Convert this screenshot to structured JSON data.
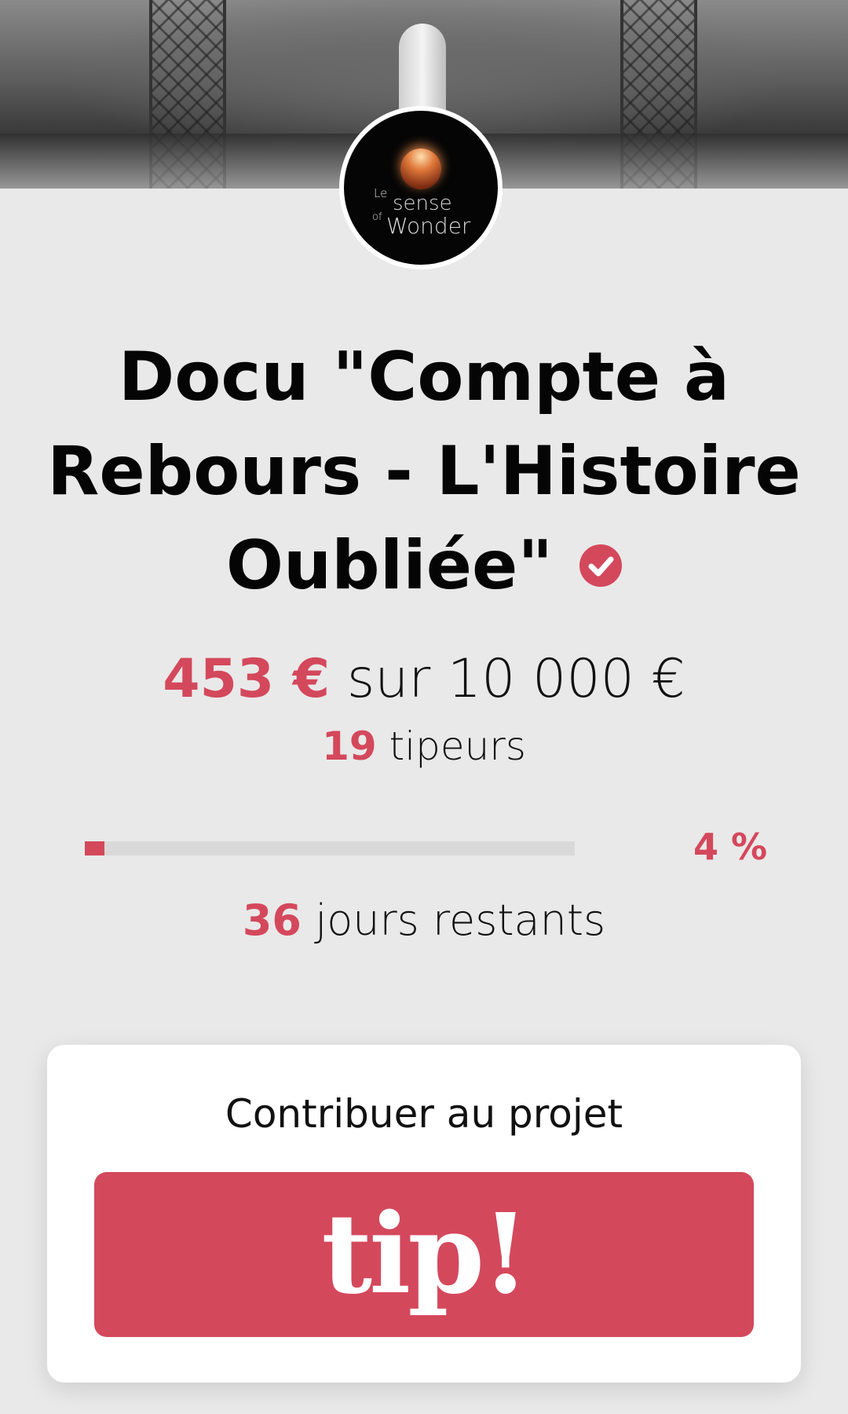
{
  "cover": {
    "image": "rocket-launch-photo"
  },
  "logo": {
    "le": "Le",
    "sense": "sense",
    "of": "of",
    "wonder": "Wonder",
    "image": "planet-sunrise"
  },
  "project": {
    "title_line1": "Docu \"Compte à",
    "title_line2": "Rebours - L'Histoire",
    "title_line3": "Oubliée\"",
    "verified_icon": "check-circle-icon"
  },
  "funding": {
    "raised": "453 €",
    "goal_text": "sur 10 000 €",
    "tippers_count": "19",
    "tippers_label": "tipeurs",
    "percent": 4,
    "percent_label": "4 %",
    "days_count": "36",
    "days_label": "jours restants"
  },
  "contribute": {
    "heading": "Contribuer au projet",
    "button_label": "tip!"
  },
  "colors": {
    "accent": "#d4485c",
    "background": "#e9e9e9"
  }
}
